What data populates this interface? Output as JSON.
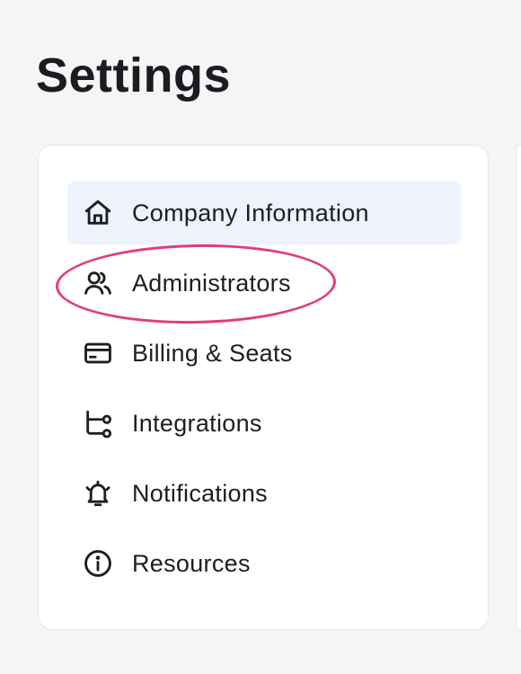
{
  "page": {
    "title": "Settings"
  },
  "menu": {
    "items": [
      {
        "label": "Company Information",
        "icon": "home-icon",
        "active": true
      },
      {
        "label": "Administrators",
        "icon": "users-icon",
        "active": false,
        "highlighted": true
      },
      {
        "label": "Billing & Seats",
        "icon": "credit-card-icon",
        "active": false
      },
      {
        "label": "Integrations",
        "icon": "integration-icon",
        "active": false
      },
      {
        "label": "Notifications",
        "icon": "bell-ring-icon",
        "active": false
      },
      {
        "label": "Resources",
        "icon": "info-icon",
        "active": false
      }
    ]
  },
  "colors": {
    "background": "#f5f5f5",
    "card": "#ffffff",
    "active_item": "#edf2fc",
    "highlight_annotation": "#e03c7d",
    "text": "#1c1e24"
  }
}
